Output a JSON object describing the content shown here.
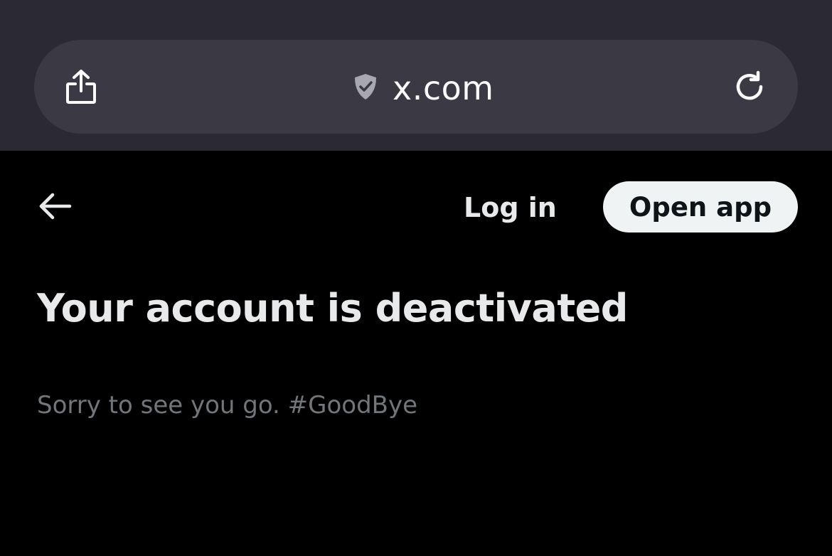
{
  "browser": {
    "url": "x.com",
    "icons": {
      "share": "share-icon",
      "site_security": "shield-check-icon",
      "reload": "reload-icon"
    },
    "colors": {
      "chrome_background": "#2b2a33",
      "url_bar_background": "#3b3a44",
      "text": "#fbfbfe"
    }
  },
  "header": {
    "back_icon": "arrow-left-icon",
    "login_label": "Log in",
    "open_app_label": "Open app"
  },
  "main": {
    "title": "Your account is deactivated",
    "subtitle": "Sorry to see you go. #GoodBye"
  },
  "colors": {
    "page_background": "#000000",
    "primary_text": "#e7e9ea",
    "secondary_text": "#71767b",
    "button_background": "#eff3f4",
    "button_text": "#0f1419"
  }
}
